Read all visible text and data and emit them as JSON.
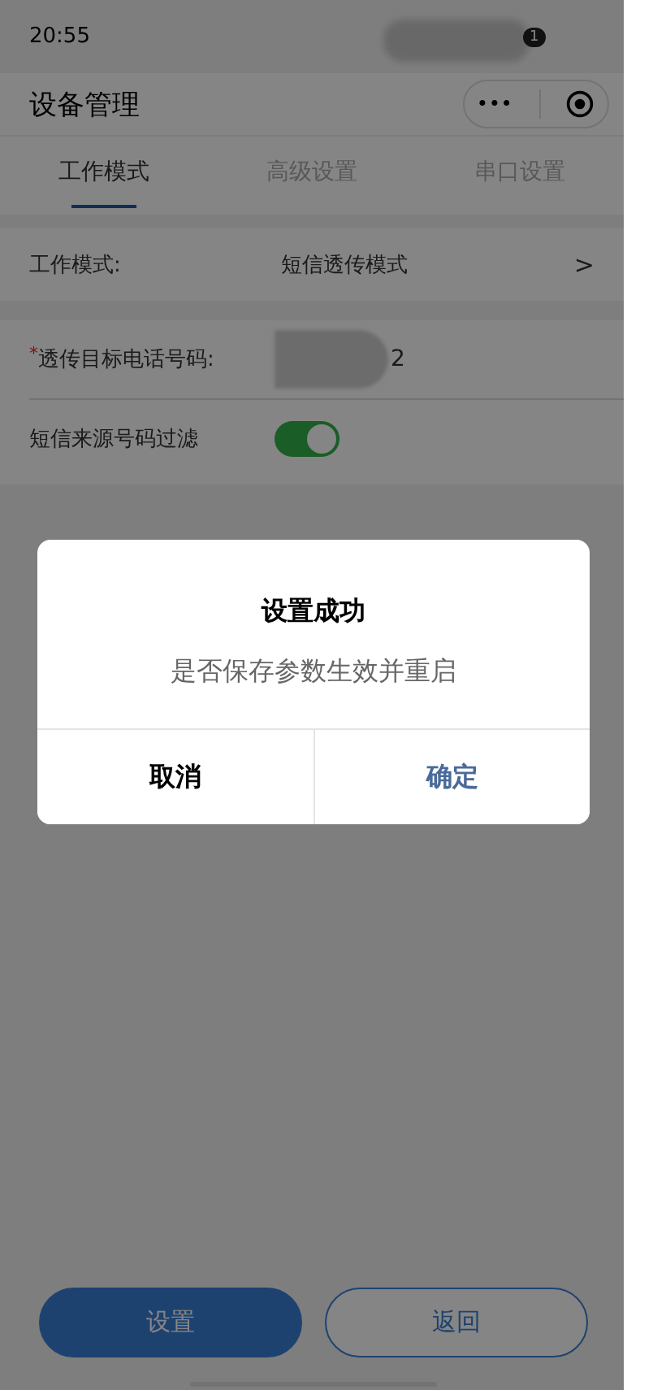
{
  "status_bar": {
    "time": "20:55",
    "battery": "1"
  },
  "nav": {
    "title": "设备管理",
    "menu": "•••"
  },
  "tabs": [
    {
      "label": "工作模式",
      "selected": true
    },
    {
      "label": "高级设置",
      "selected": false
    },
    {
      "label": "串口设置",
      "selected": false
    }
  ],
  "mode_row": {
    "label": "工作模式:",
    "value": "短信透传模式",
    "chevron": ">"
  },
  "form": [
    {
      "kind": "text",
      "mark": "*",
      "label": "透传目标电话号码:",
      "value": "2",
      "redacted": true
    },
    {
      "kind": "switch",
      "label": "短信来源号码过滤",
      "on": true
    }
  ],
  "buttons": [
    {
      "label": "设置",
      "primary": true
    },
    {
      "label": "返回",
      "primary": false
    }
  ],
  "dialog": {
    "title": "设置成功",
    "message": "是否保存参数生效并重启",
    "buttons": [
      {
        "label": "取消",
        "primary": false
      },
      {
        "label": "确定",
        "primary": true
      }
    ]
  }
}
